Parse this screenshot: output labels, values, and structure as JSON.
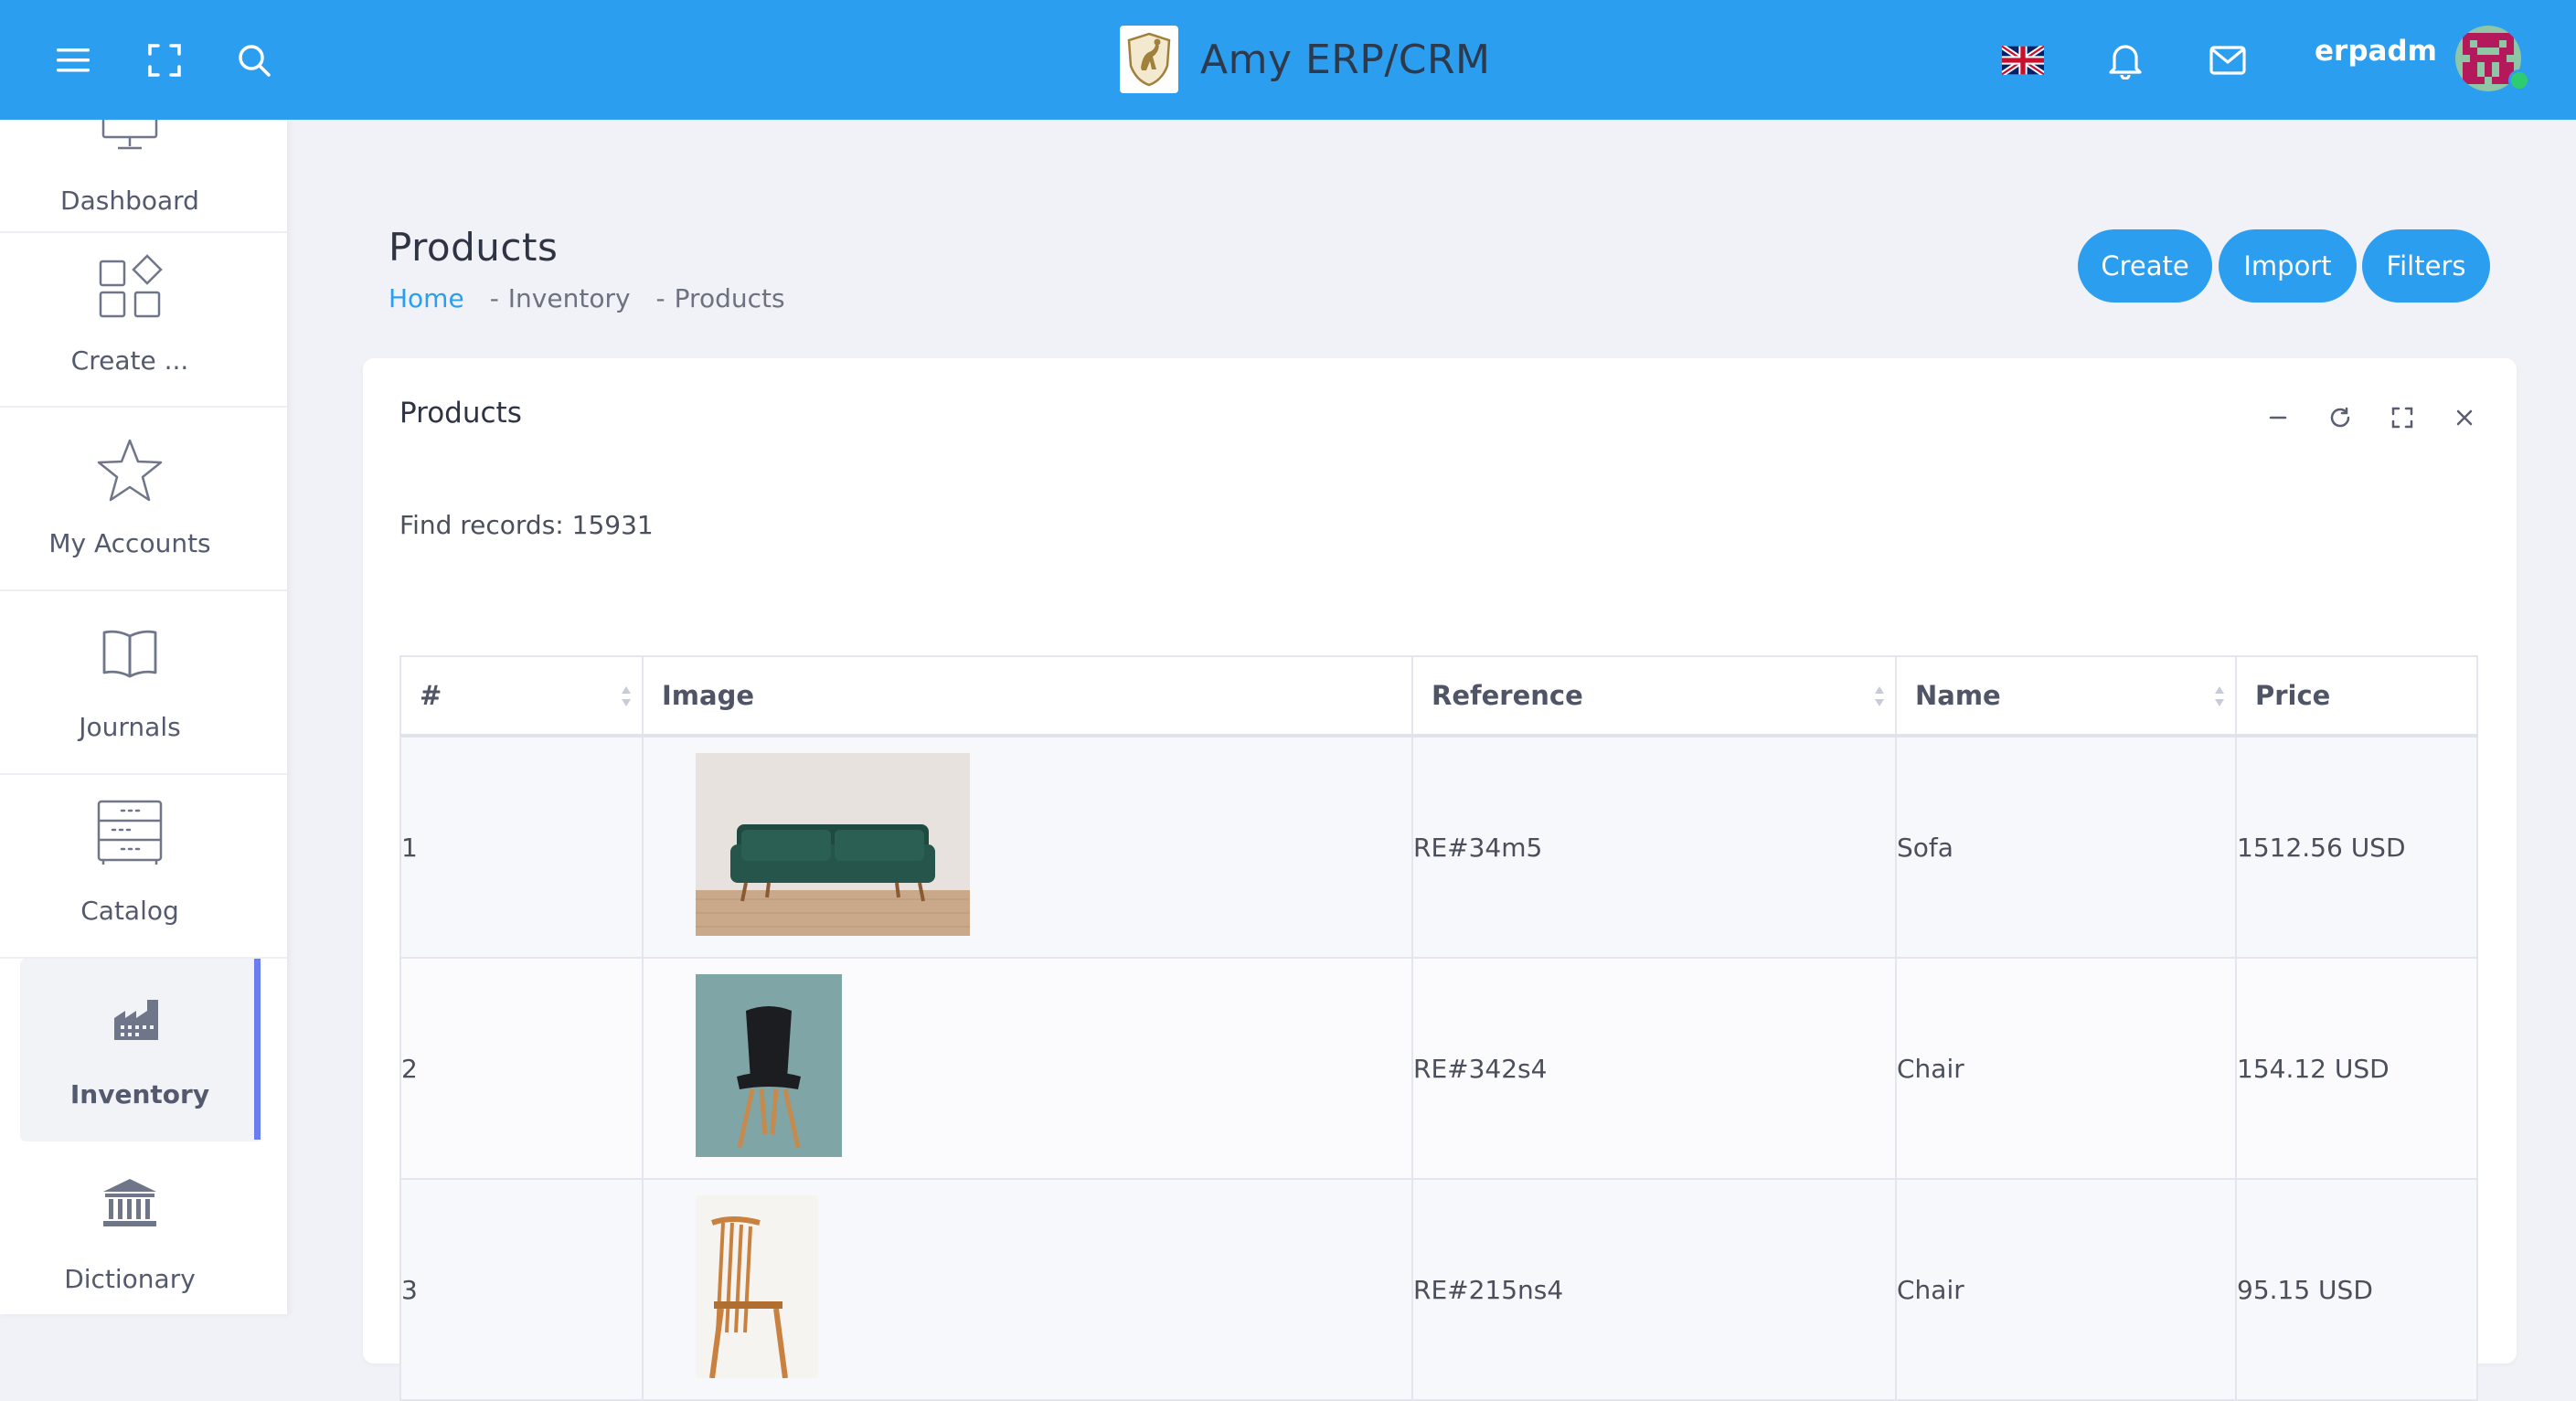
{
  "app": {
    "brand_name": "Amy ERP/CRM",
    "username": "erpadm",
    "colors": {
      "primary": "#2b9ef0",
      "sidebar_active": "#6b7df0",
      "online": "#2ecc71"
    }
  },
  "topbar_icons": [
    "menu-icon",
    "fullscreen-icon",
    "search-icon",
    "uk-flag-icon",
    "bell-icon",
    "mail-icon"
  ],
  "sidebar": {
    "items": [
      {
        "label": "Dashboard",
        "icon": "monitor-icon"
      },
      {
        "label": "Create ...",
        "icon": "grid-add-icon"
      },
      {
        "label": "My Accounts",
        "icon": "star-icon"
      },
      {
        "label": "Journals",
        "icon": "book-icon"
      },
      {
        "label": "Catalog",
        "icon": "catalog-icon"
      },
      {
        "label": "Inventory",
        "icon": "factory-icon",
        "active": true
      },
      {
        "label": "Dictionary",
        "icon": "bank-icon"
      }
    ]
  },
  "page": {
    "title": "Products",
    "breadcrumb": [
      "Home",
      "Inventory",
      "Products"
    ],
    "buttons": {
      "create": "Create",
      "import": "Import",
      "filters": "Filters"
    }
  },
  "card": {
    "title": "Products",
    "found_text": "Find records: 15931",
    "tools": [
      "minimize-icon",
      "refresh-icon",
      "expand-icon",
      "close-icon"
    ]
  },
  "table": {
    "columns": [
      "#",
      "Image",
      "Reference",
      "Name",
      "Price"
    ],
    "rows": [
      {
        "num": "1",
        "image": "green-sofa-image",
        "reference": "RE#34m5",
        "name": "Sofa",
        "price": "1512.56 USD"
      },
      {
        "num": "2",
        "image": "black-chair-image",
        "reference": "RE#342s4",
        "name": "Chair",
        "price": "154.12 USD"
      },
      {
        "num": "3",
        "image": "wooden-chair-image",
        "reference": "RE#215ns4",
        "name": "Chair",
        "price": "95.15 USD"
      }
    ]
  }
}
